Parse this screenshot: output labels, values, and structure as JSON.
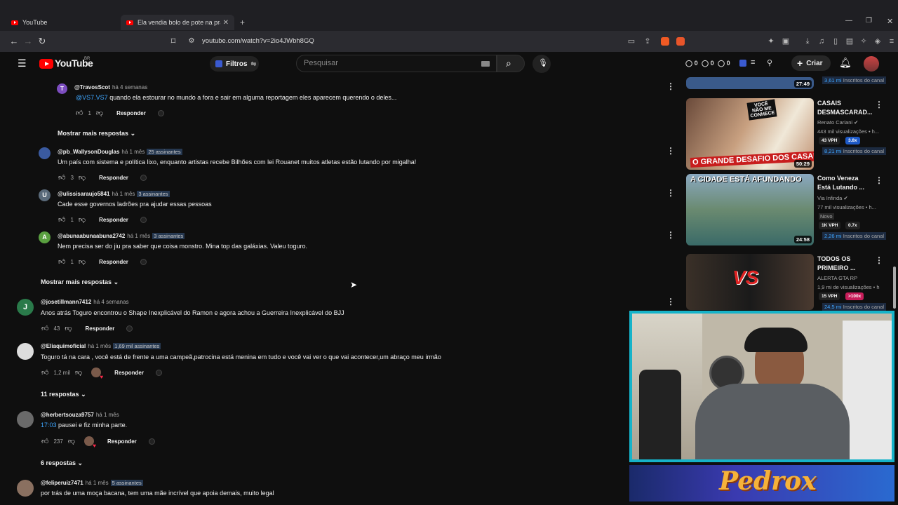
{
  "browser": {
    "tabs": [
      {
        "title": "YouTube",
        "active": false
      },
      {
        "title": "Ela vendia bolo de pote na praia",
        "active": true
      }
    ],
    "url": "youtube.com/watch?v=2io4JWbh8GQ"
  },
  "header": {
    "logo_text": "YouTube",
    "logo_region": "BR",
    "filter_label": "Filtros",
    "search_placeholder": "Pesquisar",
    "create_label": "Criar",
    "counters": [
      "0",
      "0",
      "0"
    ]
  },
  "comments": [
    {
      "user": "@TravosScot",
      "time": "há 4 semanas",
      "subs": "",
      "mention": "@VS7.VS7",
      "text": "quando ela estourar no mundo a fora e sair em alguma reportagem eles aparecem querendo o deles...",
      "likes": "1",
      "reply": "Responder",
      "avatar_letter": "T",
      "avatar_color": "#7c4dbf"
    },
    {
      "user": "@pb_WallysonDouglas",
      "time": "há 1 mês",
      "subs": "25 assinantes",
      "text": "Um país com sistema e política lixo, enquanto artistas recebe Bilhões com lei Rouanet muitos atletas estão lutando por migalha!",
      "likes": "3",
      "reply": "Responder",
      "avatar_letter": "",
      "avatar_color": "#3a5aa0"
    },
    {
      "user": "@ulissisaraujo5841",
      "time": "há 1 mês",
      "subs": "3 assinantes",
      "text": "Cade esse governos ladrões pra ajudar essas pessoas",
      "likes": "1",
      "reply": "Responder",
      "avatar_letter": "U",
      "avatar_color": "#5a6a7a"
    },
    {
      "user": "@abunaabunaabuna2742",
      "time": "há 1 mês",
      "subs": "3 assinantes",
      "text": "Nem precisa ser do jiu pra saber que coisa monstro. Mina top das galáxias. Valeu toguro.",
      "likes": "1",
      "reply": "Responder",
      "avatar_letter": "A",
      "avatar_color": "#5aa040"
    },
    {
      "user": "@josetillmann7412",
      "time": "há 4 semanas",
      "subs": "",
      "text": "Anos atrás Toguro encontrou o Shape Inexplicável do Ramon e agora achou a Guerreira Inexplicável do BJJ",
      "likes": "43",
      "reply": "Responder",
      "avatar_letter": "J",
      "avatar_color": "#2a7a4a"
    },
    {
      "user": "@Eliaquimoficial",
      "time": "há 1 mês",
      "subs": "1,69 mil assinantes",
      "text": "Toguro tá na cara , você está de frente a uma campeã,patrocina está menina em tudo e você vai ver o que vai acontecer,um abraço meu irmão",
      "likes": "1,2 mil",
      "reply": "Responder",
      "avatar_letter": "",
      "avatar_color": "#ddd"
    },
    {
      "user": "@herbertsouza9757",
      "time": "há 1 mês",
      "subs": "",
      "timestamp_link": "17:03",
      "text": "pausei e fiz minha parte.",
      "likes": "237",
      "reply": "Responder",
      "avatar_letter": "",
      "avatar_color": "#6a6a6a"
    },
    {
      "user": "@feliperuiz7471",
      "time": "há 1 mês",
      "subs": "5 assinantes",
      "text": "por trás de uma moça bacana, tem uma mãe incrível que apoia demais, muito legal",
      "likes": "",
      "reply": "Responder",
      "avatar_letter": "",
      "avatar_color": "#8a7060"
    }
  ],
  "more_replies": [
    "Mostrar mais respostas",
    "Mostrar mais respostas",
    "11 respostas",
    "6 respostas"
  ],
  "sidebar": {
    "top_partial": {
      "duration": "27:49",
      "subs_count": "3,61 mi",
      "subs_label": "Inscritos do canal"
    },
    "videos": [
      {
        "title": "CASAIS DESMASCARAD...",
        "channel": "Renato Cariani",
        "views": "443 mil visualizações • h...",
        "chips": [
          "43 VPH",
          "3.8x"
        ],
        "subs_count": "8,21 mi",
        "subs_label": "Inscritos do canal",
        "duration": "50:29",
        "thumb_text": "O GRANDE DESAFIO DOS CASAIS",
        "thumb_text2": "VOCÊ NÃO ME CONHECE"
      },
      {
        "title": "Como Veneza Está Lutando ...",
        "channel": "Via Infinda",
        "views": "77 mil visualizações • h...",
        "badge": "Novo",
        "chips": [
          "1K VPH",
          "0.7x"
        ],
        "subs_count": "2,26 mi",
        "subs_label": "Inscritos do canal",
        "duration": "24:58",
        "thumb_text": "A CIDADE ESTÁ AFUNDANDO"
      },
      {
        "title": "TODOS OS PRIMEIRO ...",
        "channel": "ALERTA GTA RP",
        "views": "1,9 mi de visualizações • h",
        "chips": [
          "15 VPH",
          ">100x"
        ],
        "subs_count": "24,5 mi",
        "subs_label": "Inscritos do canal",
        "thumb_text": "VS"
      }
    ]
  },
  "stream": {
    "banner_text": "Pedrox"
  },
  "colors": {
    "accent_blue": "#3ea6ff",
    "yt_red": "#ff0000",
    "cam_border": "#16b3c9"
  }
}
